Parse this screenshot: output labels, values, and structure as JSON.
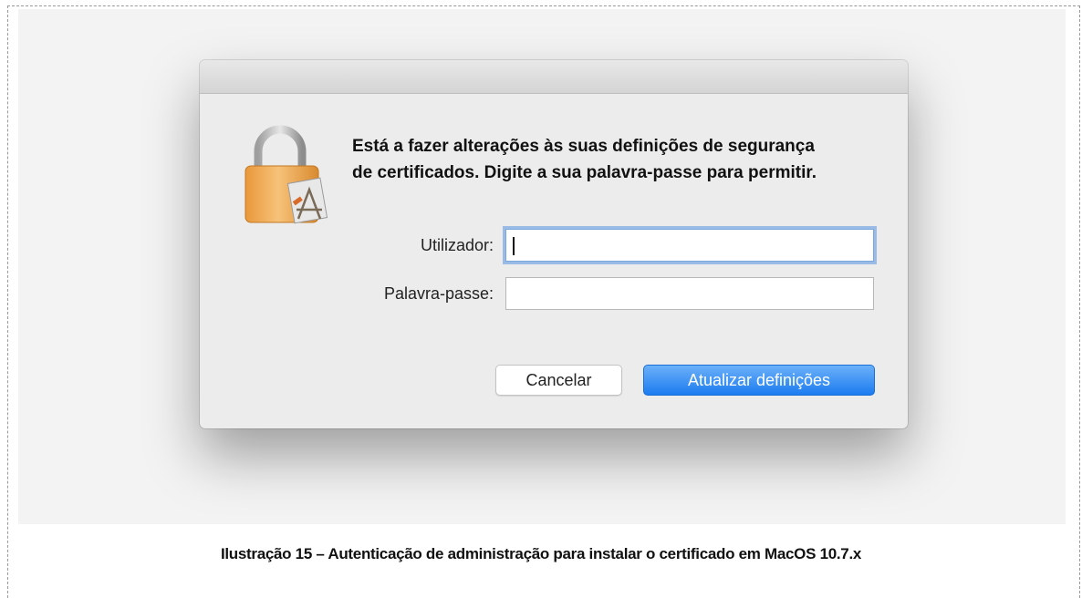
{
  "dialog": {
    "message": "Está a fazer alterações às suas definições de segurança de certificados. Digite a sua palavra-passe para permitir.",
    "username_label": "Utilizador:",
    "username_value": "",
    "password_label": "Palavra-passe:",
    "password_value": "",
    "cancel_label": "Cancelar",
    "confirm_label": "Atualizar definições",
    "icon": "lock-certificate-icon"
  },
  "caption": "Ilustração 15 – Autenticação de administração para instalar o certificado em MacOS 10.7.x",
  "colors": {
    "primary_button": "#1c7cf0",
    "focus_ring": "#5894e2",
    "dialog_bg": "#ececec"
  }
}
